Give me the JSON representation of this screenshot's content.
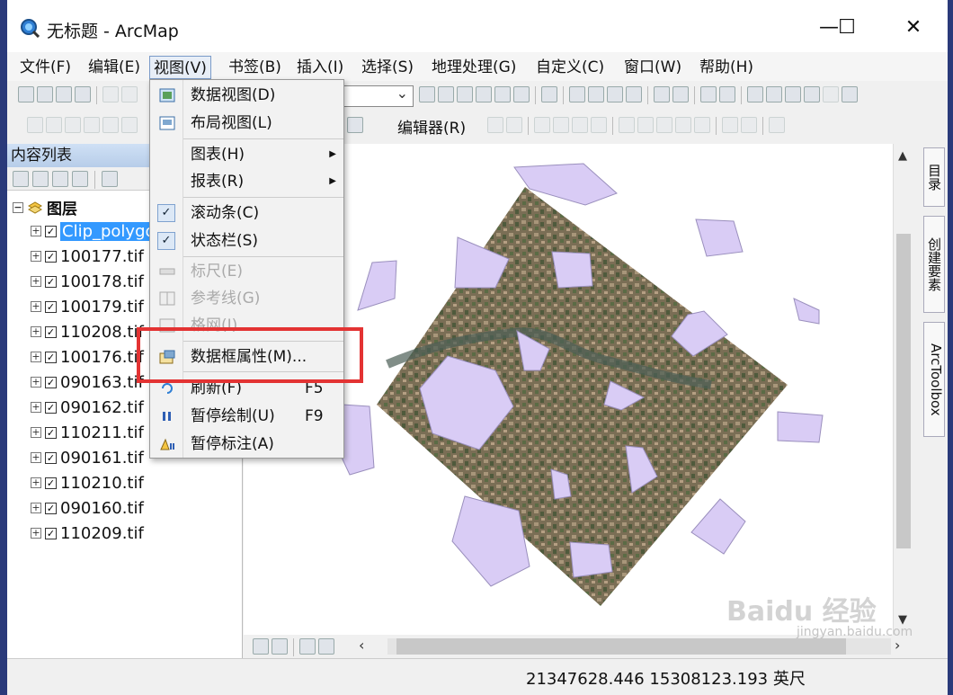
{
  "window": {
    "title": "无标题 - ArcMap",
    "minimize": "—",
    "maximize": "☐",
    "close": "✕"
  },
  "menubar": {
    "items": [
      "文件(F)",
      "编辑(E)",
      "视图(V)",
      "书签(B)",
      "插入(I)",
      "选择(S)",
      "地理处理(G)",
      "自定义(C)",
      "窗口(W)",
      "帮助(H)"
    ],
    "active": "视图(V)"
  },
  "toolbar": {
    "editor_label": "编辑器(R)"
  },
  "toc": {
    "title": "内容列表",
    "root_label": "图层",
    "layers": [
      {
        "name": "Clip_polygon",
        "checked": true,
        "selected": true
      },
      {
        "name": "100177.tif",
        "checked": true
      },
      {
        "name": "100178.tif",
        "checked": true
      },
      {
        "name": "100179.tif",
        "checked": true
      },
      {
        "name": "110208.tif",
        "checked": true
      },
      {
        "name": "100176.tif",
        "checked": true
      },
      {
        "name": "090163.tif",
        "checked": true
      },
      {
        "name": "090162.tif",
        "checked": true
      },
      {
        "name": "110211.tif",
        "checked": true
      },
      {
        "name": "090161.tif",
        "checked": true
      },
      {
        "name": "110210.tif",
        "checked": true
      },
      {
        "name": "090160.tif",
        "checked": true
      },
      {
        "name": "110209.tif",
        "checked": true
      }
    ]
  },
  "view_menu": {
    "items": [
      {
        "label": "数据视图(D)",
        "icon": "data-view-icon"
      },
      {
        "label": "布局视图(L)",
        "icon": "layout-view-icon"
      },
      {
        "label": "图表(H)",
        "submenu": true
      },
      {
        "label": "报表(R)",
        "submenu": true
      },
      {
        "label": "滚动条(C)",
        "checked": true
      },
      {
        "label": "状态栏(S)",
        "checked": true
      },
      {
        "label": "标尺(E)",
        "disabled": true,
        "icon": "ruler-icon"
      },
      {
        "label": "参考线(G)",
        "disabled": true,
        "icon": "guides-icon"
      },
      {
        "label": "格网(I)",
        "disabled": true,
        "icon": "grid-icon"
      },
      {
        "label": "数据框属性(M)...",
        "icon": "data-frame-properties-icon",
        "highlighted": true
      },
      {
        "label": "刷新(F)",
        "shortcut": "F5",
        "icon": "refresh-icon"
      },
      {
        "label": "暂停绘制(U)",
        "shortcut": "F9",
        "icon": "pause-drawing-icon"
      },
      {
        "label": "暂停标注(A)",
        "icon": "pause-labeling-icon"
      }
    ]
  },
  "side_tabs": [
    "目录",
    "创建要素",
    "ArcToolbox"
  ],
  "status": {
    "coords": "21347628.446  15308123.193 英尺"
  },
  "watermark": {
    "text": "Baidu 经验",
    "url": "jingyan.baidu.com"
  },
  "colors": {
    "polygon_fill": "#d9ccf5",
    "polygon_stroke": "#9a8fbd",
    "selection": "#3399ff",
    "highlight_box": "#e33333"
  }
}
